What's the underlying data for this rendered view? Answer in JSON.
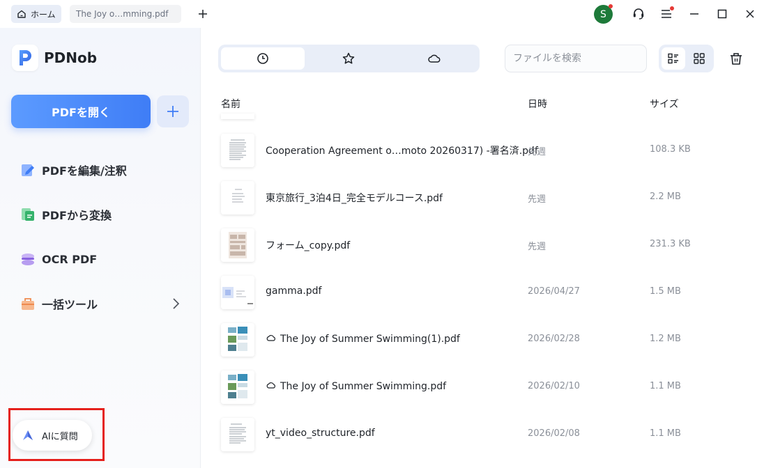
{
  "titlebar": {
    "home_tab": "ホーム",
    "file_tab": "The Joy o…mming.pdf",
    "avatar_letter": "S"
  },
  "sidebar": {
    "brand": "PDNob",
    "open_button": "PDFを開く",
    "nav": [
      {
        "label": "PDFを編集/注釈",
        "icon": "edit-icon"
      },
      {
        "label": "PDFから変換",
        "icon": "convert-icon"
      },
      {
        "label": "OCR PDF",
        "icon": "ocr-icon"
      },
      {
        "label": "一括ツール",
        "icon": "toolbox-icon"
      }
    ],
    "ai_button": "AIに質問"
  },
  "main": {
    "search_placeholder": "ファイルを検索",
    "columns": {
      "name": "名前",
      "date": "日時",
      "size": "サイズ"
    },
    "files": [
      {
        "name": "Cooperation Agreement o…moto 20260317) -署名済.pdf",
        "date": "先週",
        "size": "108.3 KB",
        "cloud": false
      },
      {
        "name": "東京旅行_3泊4日_完全モデルコース.pdf",
        "date": "先週",
        "size": "2.2 MB",
        "cloud": false
      },
      {
        "name": "フォーム_copy.pdf",
        "date": "先週",
        "size": "231.3 KB",
        "cloud": false
      },
      {
        "name": "gamma.pdf",
        "date": "2026/04/27",
        "size": "1.5 MB",
        "cloud": false
      },
      {
        "name": "The Joy of Summer Swimming(1).pdf",
        "date": "2026/02/28",
        "size": "1.2 MB",
        "cloud": true
      },
      {
        "name": "The Joy of Summer Swimming.pdf",
        "date": "2026/02/10",
        "size": "1.1 MB",
        "cloud": true
      },
      {
        "name": "yt_video_structure.pdf",
        "date": "2026/02/08",
        "size": "1.1 MB",
        "cloud": false
      }
    ]
  },
  "colors": {
    "accent": "#3f7df6",
    "highlight_box": "#e5201c",
    "avatar": "#1e7a3a"
  }
}
